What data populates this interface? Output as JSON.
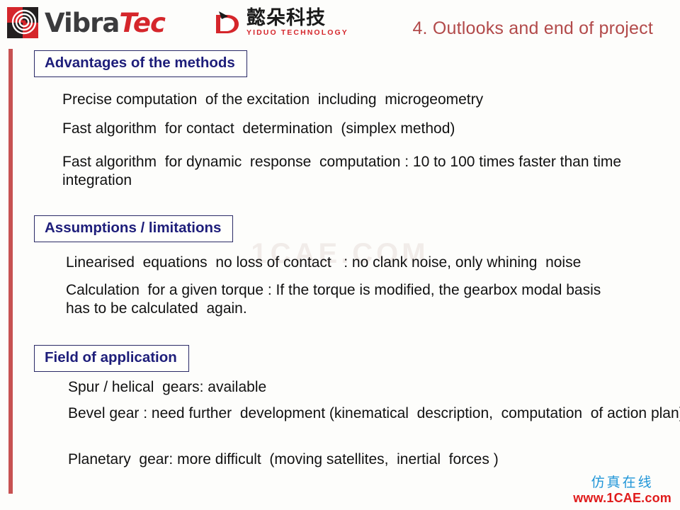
{
  "header": {
    "vibratec_logo": {
      "name": "vibratec-logo",
      "word_primary": "Vibra",
      "word_accent": "Tec",
      "mark_icon": "concentric-rings-icon",
      "colors": {
        "dark": "#3b3b3d",
        "red": "#d5262b"
      }
    },
    "yiduo_logo": {
      "name": "yiduo-logo",
      "mark_icon": "stylized-d-icon",
      "chinese_name": "懿朵科技",
      "english_name": "YIDUO TECHNOLOGY",
      "colors": {
        "red": "#d5262b",
        "dark": "#1a1a1a"
      }
    },
    "title": "4. Outlooks and end of project",
    "title_color": "#b24a4a"
  },
  "accent_bar_color": "#c75252",
  "sections": [
    {
      "heading": "Advantages of the methods",
      "lines": [
        "Precise computation  of the excitation  including  microgeometry",
        "Fast algorithm  for contact  determination  (simplex method)",
        "Fast algorithm  for dynamic  response  computation : 10 to 100 times faster than time integration"
      ]
    },
    {
      "heading": "Assumptions  / limitations",
      "lines": [
        "Linearised  equations  no loss of contact   : no clank noise, only whining  noise",
        "Calculation  for a given torque : If the torque is modified, the gearbox modal basis has to be calculated  again."
      ]
    },
    {
      "heading": "Field of application",
      "lines": [
        "Spur / helical  gears: available",
        "Bevel gear : need further  development (kinematical  description,  computation  of action plan)",
        "Planetary  gear: more difficult  (moving satellites,  inertial  forces )"
      ]
    }
  ],
  "watermarks": {
    "center": "1CAE.COM",
    "corner_chinese": "仿真在线",
    "corner_url": "www.1CAE.com",
    "corner_chinese_color": "#2196d8",
    "corner_url_color": "#e01b1b"
  },
  "heading_text_color": "#1e1e7a"
}
